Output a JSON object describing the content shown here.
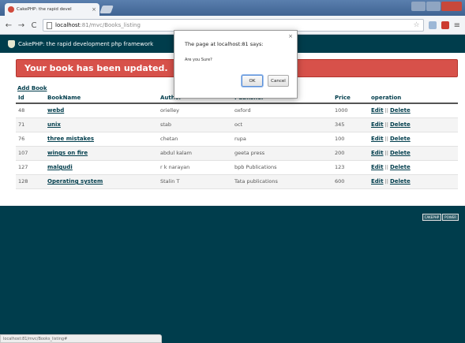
{
  "browser": {
    "tab_title": "CakePHP: the rapid devel",
    "tab_close": "×",
    "url_host": "localhost",
    "url_path": ":81/mvc/Books_listing",
    "nav": {
      "back": "←",
      "forward": "→",
      "reload": "C"
    },
    "star": "☆",
    "menu": "≡"
  },
  "header": {
    "title": "CakePHP: the rapid development php framework"
  },
  "flash": {
    "message": "Your book has been updated."
  },
  "add_book_label": "Add Book",
  "table": {
    "headers": [
      "Id",
      "BookName",
      "Author",
      "Publisher",
      "Price",
      "operation"
    ],
    "rows": [
      {
        "id": "48",
        "name": "webd",
        "author": "orielley",
        "publisher": "oxford",
        "price": "1000"
      },
      {
        "id": "71",
        "name": "unix",
        "author": "stab",
        "publisher": "oct",
        "price": "345"
      },
      {
        "id": "76",
        "name": "three mistakes",
        "author": "chetan",
        "publisher": "rupa",
        "price": "100"
      },
      {
        "id": "107",
        "name": "wings on fire",
        "author": "abdul kalam",
        "publisher": "geeta press",
        "price": "200"
      },
      {
        "id": "127",
        "name": "malgudi",
        "author": "r k narayan",
        "publisher": "bpb Publications",
        "price": "123"
      },
      {
        "id": "128",
        "name": "Operating system",
        "author": "Stalin T",
        "publisher": "Tata publications",
        "price": "600"
      }
    ],
    "edit_label": "Edit",
    "separator": "||",
    "delete_label": "Delete"
  },
  "footer": {
    "badge_left": "CAKEPHP",
    "badge_right": "POWER"
  },
  "status_bar": {
    "text": "localhost:81/mvc/Books_listing#"
  },
  "dialog": {
    "title": "The page at localhost:81 says:",
    "message": "Are you Sure?",
    "ok_label": "OK",
    "cancel_label": "Cancel",
    "close": "×"
  }
}
